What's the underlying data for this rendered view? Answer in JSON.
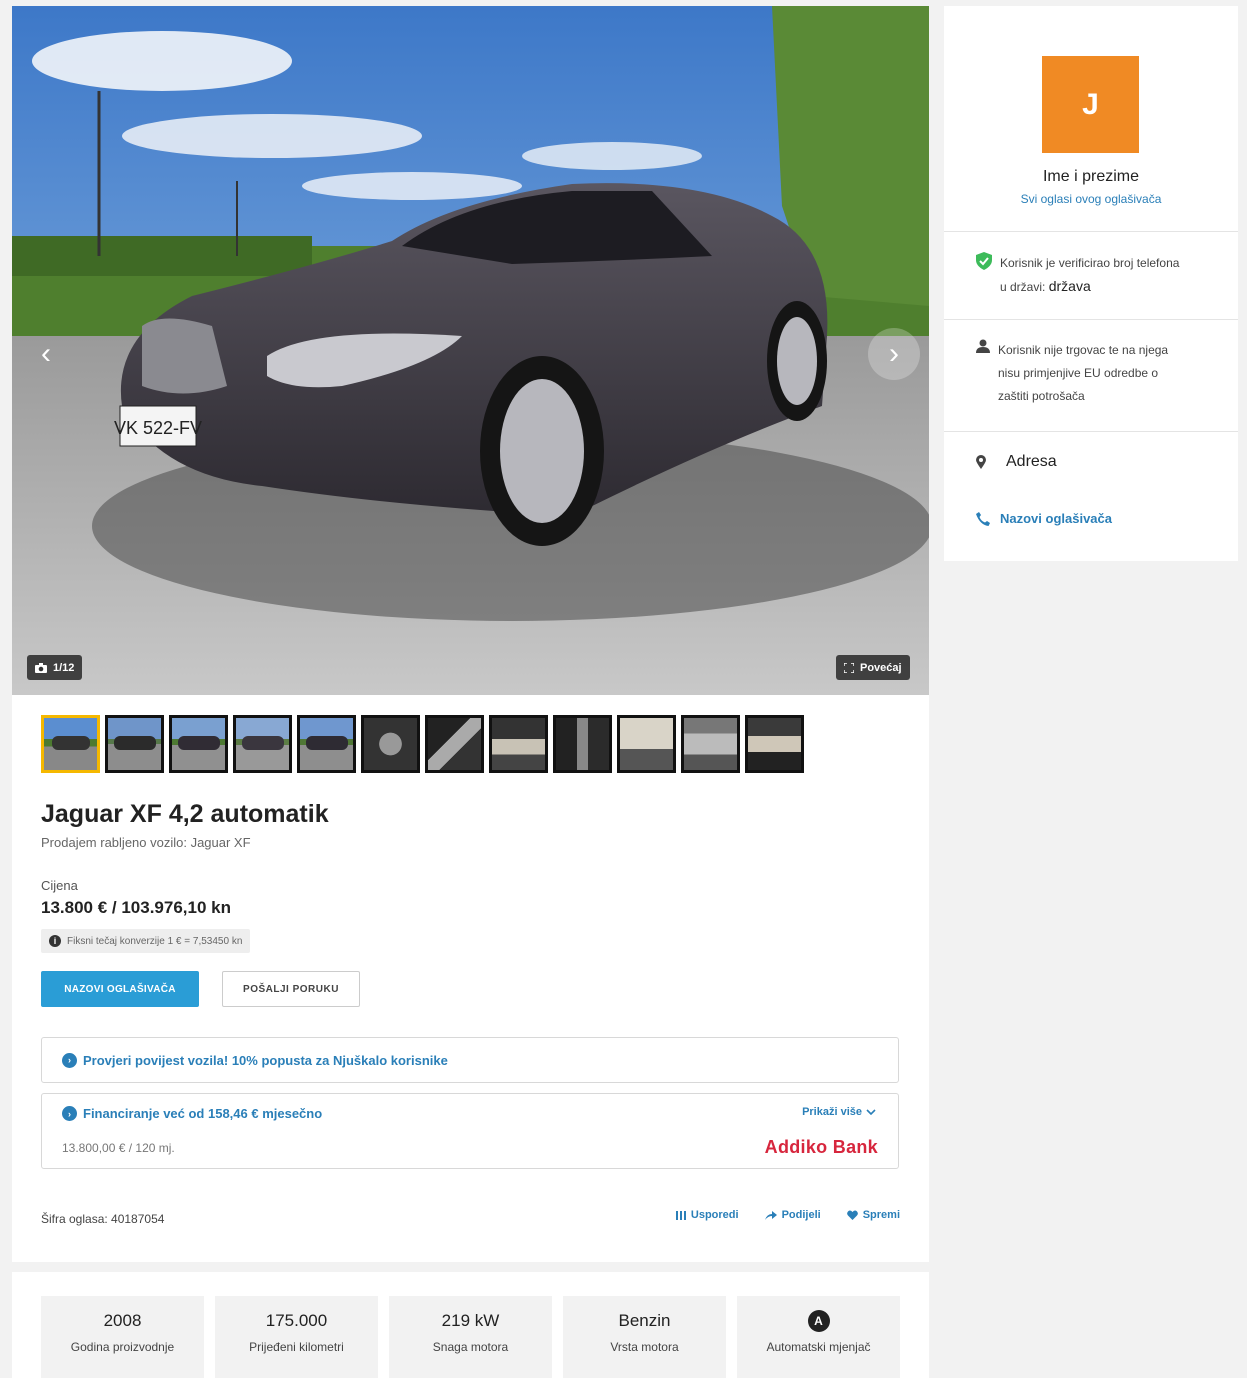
{
  "gallery": {
    "counter": "1/12",
    "zoom_label": "Povećaj",
    "prev_icon": "chevron-left-icon",
    "next_icon": "chevron-right-icon",
    "plate_text": "VK 522-FV",
    "thumbnail_count": 12
  },
  "listing": {
    "title": "Jaguar XF 4,2 automatik",
    "subtitle": "Prodajem rabljeno vozilo: Jaguar XF",
    "price_label": "Cijena",
    "price": "13.800 € / 103.976,10 kn",
    "fx_note": "Fiksni tečaj konverzije 1 € = 7,53450 kn",
    "call_button": "NAZOVI OGLAŠIVAČA",
    "message_button": "POŠALJI PORUKU",
    "history_link": "Provjeri povijest vozila! 10% popusta za Njuškalo korisnike",
    "finance_link": "Financiranje već od 158,46 € mjesečno",
    "finance_more": "Prikaži više",
    "finance_sub": "13.800,00 € / 120 mj.",
    "bank_name": "Addiko Bank",
    "ad_id": "Šifra oglasa: 40187054",
    "actions": {
      "compare": "Usporedi",
      "share": "Podijeli",
      "save": "Spremi"
    }
  },
  "specs": [
    {
      "value": "2008",
      "label": "Godina proizvodnje"
    },
    {
      "value": "175.000",
      "label": "Prijeđeni kilometri"
    },
    {
      "value": "219 kW",
      "label": "Snaga motora"
    },
    {
      "value": "Benzin",
      "label": "Vrsta motora"
    },
    {
      "value": "A",
      "label": "Automatski mjenjač"
    }
  ],
  "seller": {
    "avatar_letter": "J",
    "name": "Ime i prezime",
    "all_ads": "Svi oglasi ovog oglašivača",
    "verified_line1": "Korisnik je verificirao broj telefona",
    "verified_line2_prefix": "u državi:",
    "verified_country": "država",
    "trader_line1": "Korisnik nije trgovac te na njega",
    "trader_line2": "nisu primjenjive EU odredbe o",
    "trader_line3": "zaštiti potrošača",
    "address": "Adresa",
    "call_link": "Nazovi oglašivača"
  },
  "colors": {
    "accent_blue": "#2a9dd6",
    "link_blue": "#2a7fb8",
    "avatar_orange": "#f08a24",
    "bank_red": "#d7263d",
    "active_thumb": "#f5b800"
  }
}
